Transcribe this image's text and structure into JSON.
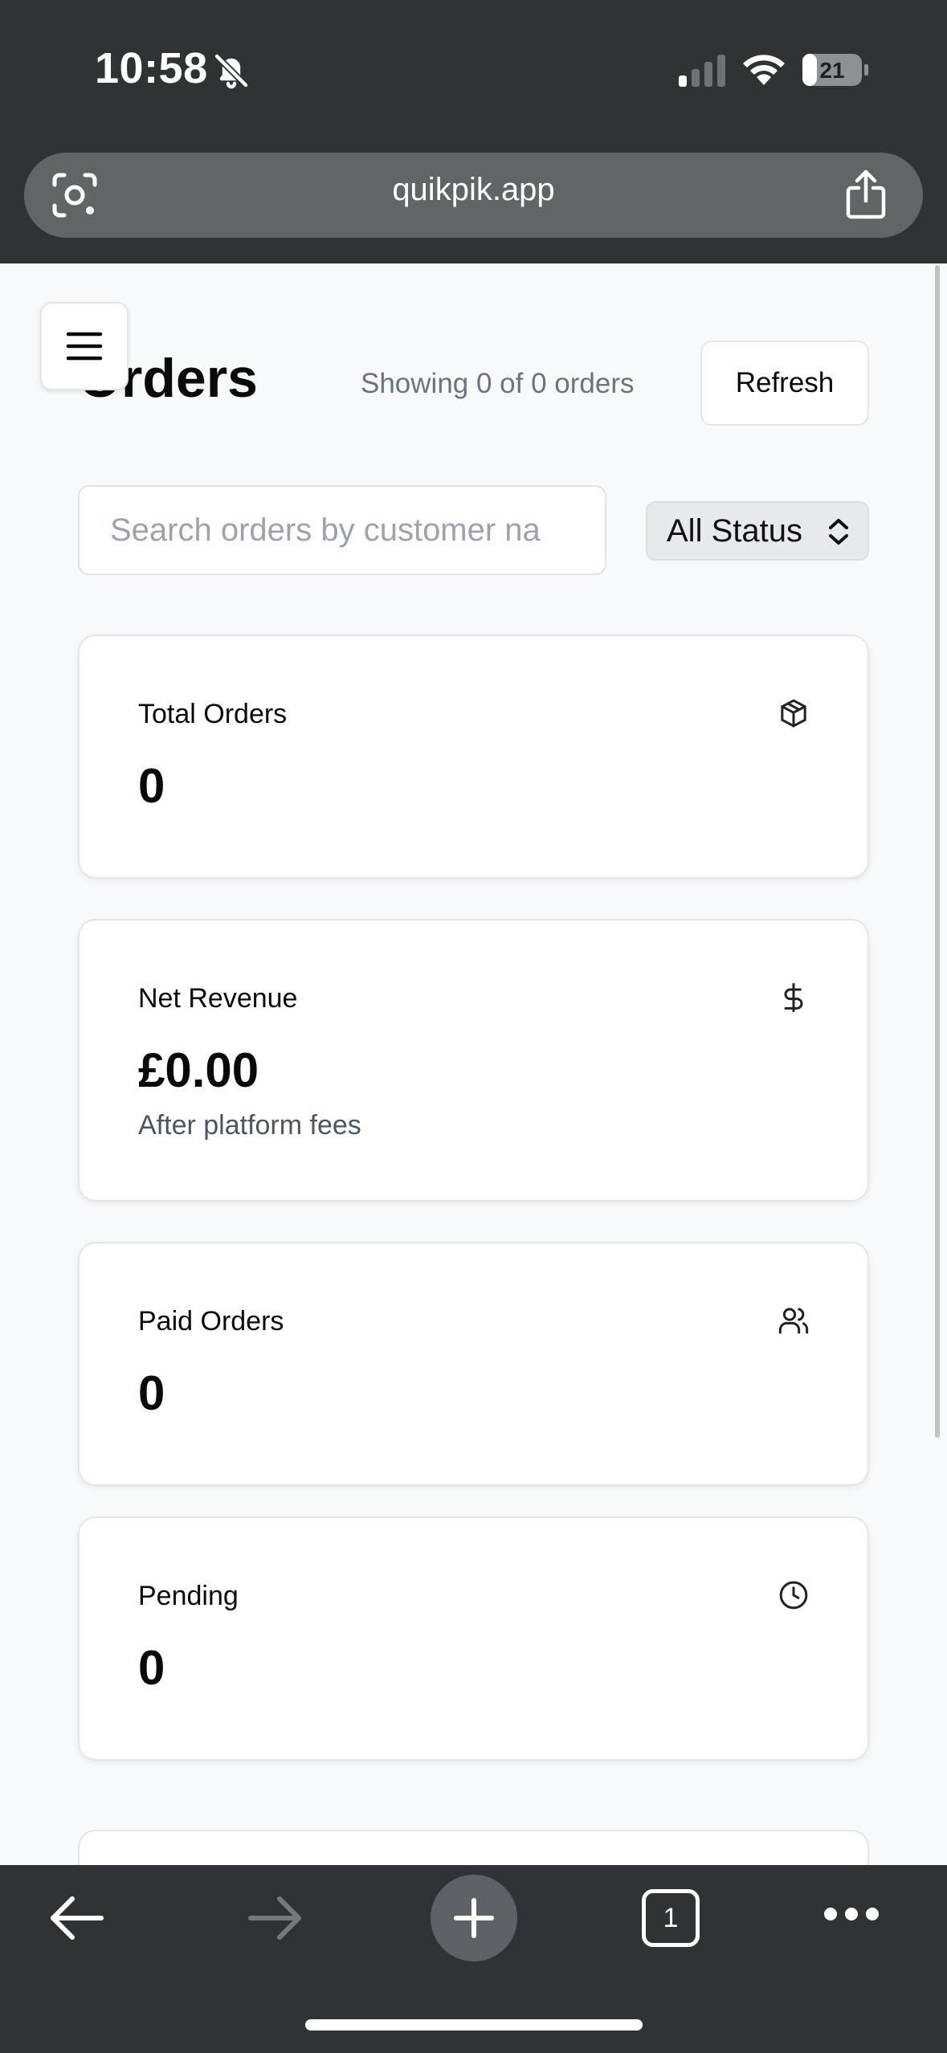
{
  "status_bar": {
    "time": "10:58",
    "battery_level": "21",
    "icons": [
      "bell-slash-icon",
      "signal-icon",
      "wifi-icon",
      "battery-icon"
    ]
  },
  "browser": {
    "url": "quikpik.app",
    "icons": [
      "lens-icon",
      "share-icon"
    ]
  },
  "header": {
    "title": "Orders",
    "showing_text": "Showing 0 of 0 orders",
    "refresh_label": "Refresh",
    "menu_icon": "hamburger-menu-icon"
  },
  "filters": {
    "search_placeholder": "Search orders by customer na",
    "status_selected": "All Status"
  },
  "stats": {
    "total_orders": {
      "label": "Total Orders",
      "value": "0",
      "icon": "package-icon"
    },
    "net_revenue": {
      "label": "Net Revenue",
      "value": "£0.00",
      "sub": "After platform fees",
      "icon": "dollar-icon"
    },
    "paid_orders": {
      "label": "Paid Orders",
      "value": "0",
      "icon": "users-icon"
    },
    "pending": {
      "label": "Pending",
      "value": "0",
      "icon": "clock-icon"
    }
  },
  "toolbar": {
    "tab_count": "1",
    "icons": [
      "back-arrow-icon",
      "forward-arrow-icon",
      "plus-icon",
      "tabs-icon",
      "more-icon"
    ]
  },
  "colors": {
    "chrome_dark": "#303336",
    "url_bar": "#616568",
    "page_bg": "#f8f9fa",
    "card_bg": "#ffffff",
    "muted_text": "#6b7280"
  }
}
